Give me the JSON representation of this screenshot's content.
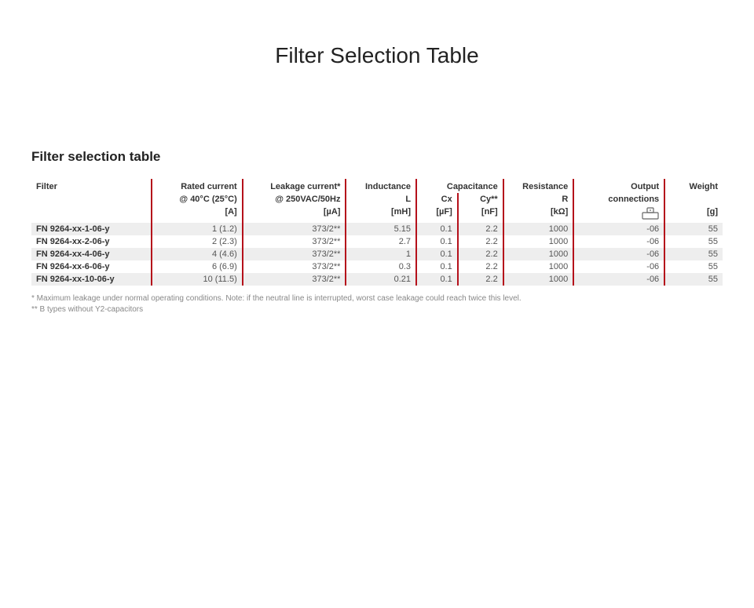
{
  "page_title": "Filter Selection Table",
  "section_heading": "Filter selection table",
  "columns": {
    "filter": {
      "h1": "Filter",
      "h2": "",
      "unit": ""
    },
    "rated_current": {
      "h1": "Rated current",
      "h2": "@ 40°C (25°C)",
      "unit": "[A]"
    },
    "leakage": {
      "h1": "Leakage current*",
      "h2": "@ 250VAC/50Hz",
      "unit": "[µA]"
    },
    "inductance": {
      "h1": "Inductance",
      "h2": "L",
      "unit": "[mH]"
    },
    "cap_group": {
      "h1": "Capacitance"
    },
    "cx": {
      "h2": "Cx",
      "unit": "[µF]"
    },
    "cy": {
      "h2": "Cy**",
      "unit": "[nF]"
    },
    "resistance": {
      "h1": "Resistance",
      "h2": "R",
      "unit": "[kΩ]"
    },
    "output": {
      "h1": "Output",
      "h2": "connections",
      "unit": ""
    },
    "weight": {
      "h1": "Weight",
      "h2": "",
      "unit": "[g]"
    }
  },
  "rows": [
    {
      "filter": "FN 9264-xx-1-06-y",
      "rated": "1 (1.2)",
      "leak": "373/2**",
      "ind": "5.15",
      "cx": "0.1",
      "cy": "2.2",
      "res": "1000",
      "out": "-06",
      "wt": "55"
    },
    {
      "filter": "FN 9264-xx-2-06-y",
      "rated": "2 (2.3)",
      "leak": "373/2**",
      "ind": "2.7",
      "cx": "0.1",
      "cy": "2.2",
      "res": "1000",
      "out": "-06",
      "wt": "55"
    },
    {
      "filter": "FN 9264-xx-4-06-y",
      "rated": "4 (4.6)",
      "leak": "373/2**",
      "ind": "1",
      "cx": "0.1",
      "cy": "2.2",
      "res": "1000",
      "out": "-06",
      "wt": "55"
    },
    {
      "filter": "FN 9264-xx-6-06-y",
      "rated": "6 (6.9)",
      "leak": "373/2**",
      "ind": "0.3",
      "cx": "0.1",
      "cy": "2.2",
      "res": "1000",
      "out": "-06",
      "wt": "55"
    },
    {
      "filter": "FN 9264-xx-10-06-y",
      "rated": "10 (11.5)",
      "leak": "373/2**",
      "ind": "0.21",
      "cx": "0.1",
      "cy": "2.2",
      "res": "1000",
      "out": "-06",
      "wt": "55"
    }
  ],
  "footnotes": [
    "* Maximum leakage under normal operating conditions. Note: if the neutral line is interrupted, worst case leakage could reach twice this level.",
    "** B types without Y2-capacitors"
  ],
  "chart_data": {
    "type": "table",
    "title": "Filter selection table",
    "columns": [
      "Filter",
      "Rated current @40°C (25°C) [A]",
      "Leakage current @250VAC/50Hz [µA]",
      "Inductance L [mH]",
      "Capacitance Cx [µF]",
      "Capacitance Cy [nF]",
      "Resistance R [kΩ]",
      "Output connections",
      "Weight [g]"
    ],
    "rows": [
      [
        "FN 9264-xx-1-06-y",
        "1 (1.2)",
        "373/2**",
        5.15,
        0.1,
        2.2,
        1000,
        "-06",
        55
      ],
      [
        "FN 9264-xx-2-06-y",
        "2 (2.3)",
        "373/2**",
        2.7,
        0.1,
        2.2,
        1000,
        "-06",
        55
      ],
      [
        "FN 9264-xx-4-06-y",
        "4 (4.6)",
        "373/2**",
        1,
        0.1,
        2.2,
        1000,
        "-06",
        55
      ],
      [
        "FN 9264-xx-6-06-y",
        "6 (6.9)",
        "373/2**",
        0.3,
        0.1,
        2.2,
        1000,
        "-06",
        55
      ],
      [
        "FN 9264-xx-10-06-y",
        "10 (11.5)",
        "373/2**",
        0.21,
        0.1,
        2.2,
        1000,
        "-06",
        55
      ]
    ]
  }
}
